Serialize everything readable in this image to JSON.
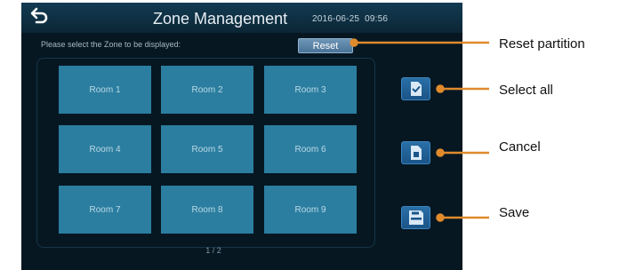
{
  "screen": {
    "title": "Zone Management",
    "date": "2016-06-25",
    "time": "09:56",
    "instruction": "Please select the Zone to be displayed:",
    "reset_label": "Reset",
    "rooms": [
      "Room 1",
      "Room 2",
      "Room 3",
      "Room 4",
      "Room 5",
      "Room 6",
      "Room 7",
      "Room 8",
      "Room 9"
    ],
    "page_indicator": "1 / 2",
    "side_buttons": [
      {
        "icon": "select-all-icon"
      },
      {
        "icon": "cancel-icon"
      },
      {
        "icon": "save-icon"
      }
    ]
  },
  "callouts": {
    "reset_partition": "Reset  partition",
    "select_all": "Select  all",
    "cancel": "Cancel",
    "save": "Save"
  },
  "colors": {
    "screen_background": "#061722",
    "room_tile": "#2b7ea0",
    "reset_button": "#5a82a6",
    "side_button": "#1f5f97",
    "callout_line": "#e08a2c"
  }
}
